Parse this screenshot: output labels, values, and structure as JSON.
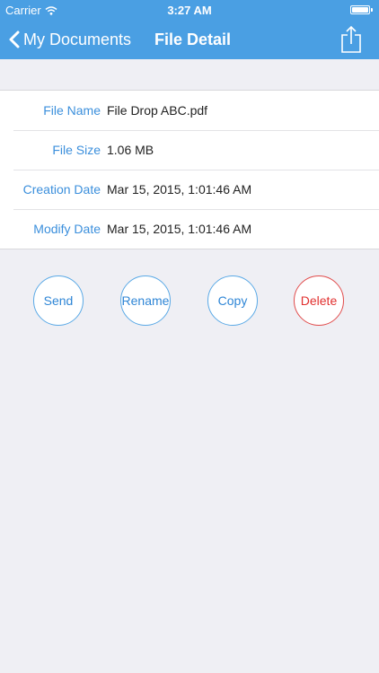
{
  "status_bar": {
    "carrier": "Carrier",
    "time": "3:27 AM",
    "battery_level": 1.0
  },
  "nav": {
    "back_label": "My Documents",
    "title": "File Detail",
    "share_icon": "share-icon"
  },
  "details": [
    {
      "label": "File Name",
      "value": "File Drop ABC.pdf"
    },
    {
      "label": "File Size",
      "value": "1.06 MB"
    },
    {
      "label": "Creation Date",
      "value": "Mar 15, 2015, 1:01:46 AM"
    },
    {
      "label": "Modify Date",
      "value": "Mar 15, 2015, 1:01:46 AM"
    }
  ],
  "actions": {
    "send": "Send",
    "rename": "Rename",
    "copy": "Copy",
    "delete": "Delete"
  },
  "colors": {
    "nav_bg": "#4a9fe3",
    "label": "#3b8fdc",
    "delete": "#e1302f",
    "background": "#efeff4"
  }
}
